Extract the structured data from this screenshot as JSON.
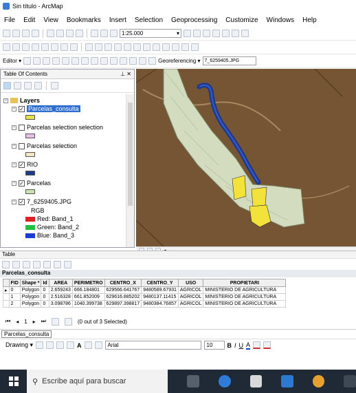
{
  "window": {
    "title": "Sin título - ArcMap"
  },
  "menu": [
    "File",
    "Edit",
    "View",
    "Bookmarks",
    "Insert",
    "Selection",
    "Geoprocessing",
    "Customize",
    "Windows",
    "Help"
  ],
  "toolbar": {
    "scale": "1:25.000",
    "editor_label": "Editor ▾",
    "georef_label": "Georeferencing ▾",
    "georef_layer": "7_6259405.JPG"
  },
  "toc": {
    "title": "Table Of Contents",
    "close": "⊥ ✕",
    "group": "Layers",
    "layers": [
      {
        "label": "Parcelas_consulta",
        "checked": true,
        "swatch": "#e8e24a"
      },
      {
        "label": "Parcelas selection selection",
        "checked": false,
        "swatch": "#e8bfe6"
      },
      {
        "label": "Parcelas selection",
        "checked": false,
        "swatch": "#f4e7c4"
      },
      {
        "label": "RIO",
        "checked": true,
        "swatch": "#1c3d8c"
      },
      {
        "label": "Parcelas",
        "checked": true,
        "swatch": "#c9e3b0"
      },
      {
        "label": "7_6259405.JPG",
        "checked": true
      }
    ],
    "raster_rgb": "RGB",
    "bands": [
      {
        "label": "Red:   Band_1",
        "color": "#e02020"
      },
      {
        "label": "Green: Band_2",
        "color": "#20c040"
      },
      {
        "label": "Blue:  Band_3",
        "color": "#1a3cd6"
      }
    ]
  },
  "table": {
    "panel_title": "Table",
    "layer_name": "Parcelas_consulta",
    "columns": [
      "FID",
      "Shape *",
      "Id",
      "AREA",
      "PERIMETRO",
      "CENTRO_X",
      "CENTRO_Y",
      "USO",
      "PROPIETARI"
    ],
    "rows": [
      [
        "0",
        "Polygon",
        "0",
        "2.659243",
        "666.184801",
        "629566.641767",
        "9480589.67931",
        "AGRICOL",
        "MINISTERIO DE AGRICULTURA"
      ],
      [
        "1",
        "Polygon",
        "0",
        "2.516328",
        "661.852009",
        "629616.885202",
        "9480137.11415",
        "AGRICOL",
        "MINISTERIO DE AGRICULTURA"
      ],
      [
        "2",
        "Polygon",
        "0",
        "3.098786",
        "1040.399738",
        "629897.398817",
        "9480384.76857",
        "AGRICOL",
        "MINISTERIO DE AGRICULTURA"
      ]
    ],
    "nav_first": "⏮",
    "nav_record": "1",
    "nav_status": "(0 out of 3 Selected)",
    "tab_label": "Parcelas_consulta"
  },
  "draw": {
    "label": "Drawing ▾",
    "font": "Arial",
    "size": "10"
  },
  "taskbar": {
    "search_placeholder": "Escribe aquí para buscar"
  },
  "colors": {
    "river": "#1b3a8f",
    "parcel_fill": "#d4dcc0",
    "selected_parcel": "#f2e23a",
    "map_bg": "#6b4a2c"
  }
}
